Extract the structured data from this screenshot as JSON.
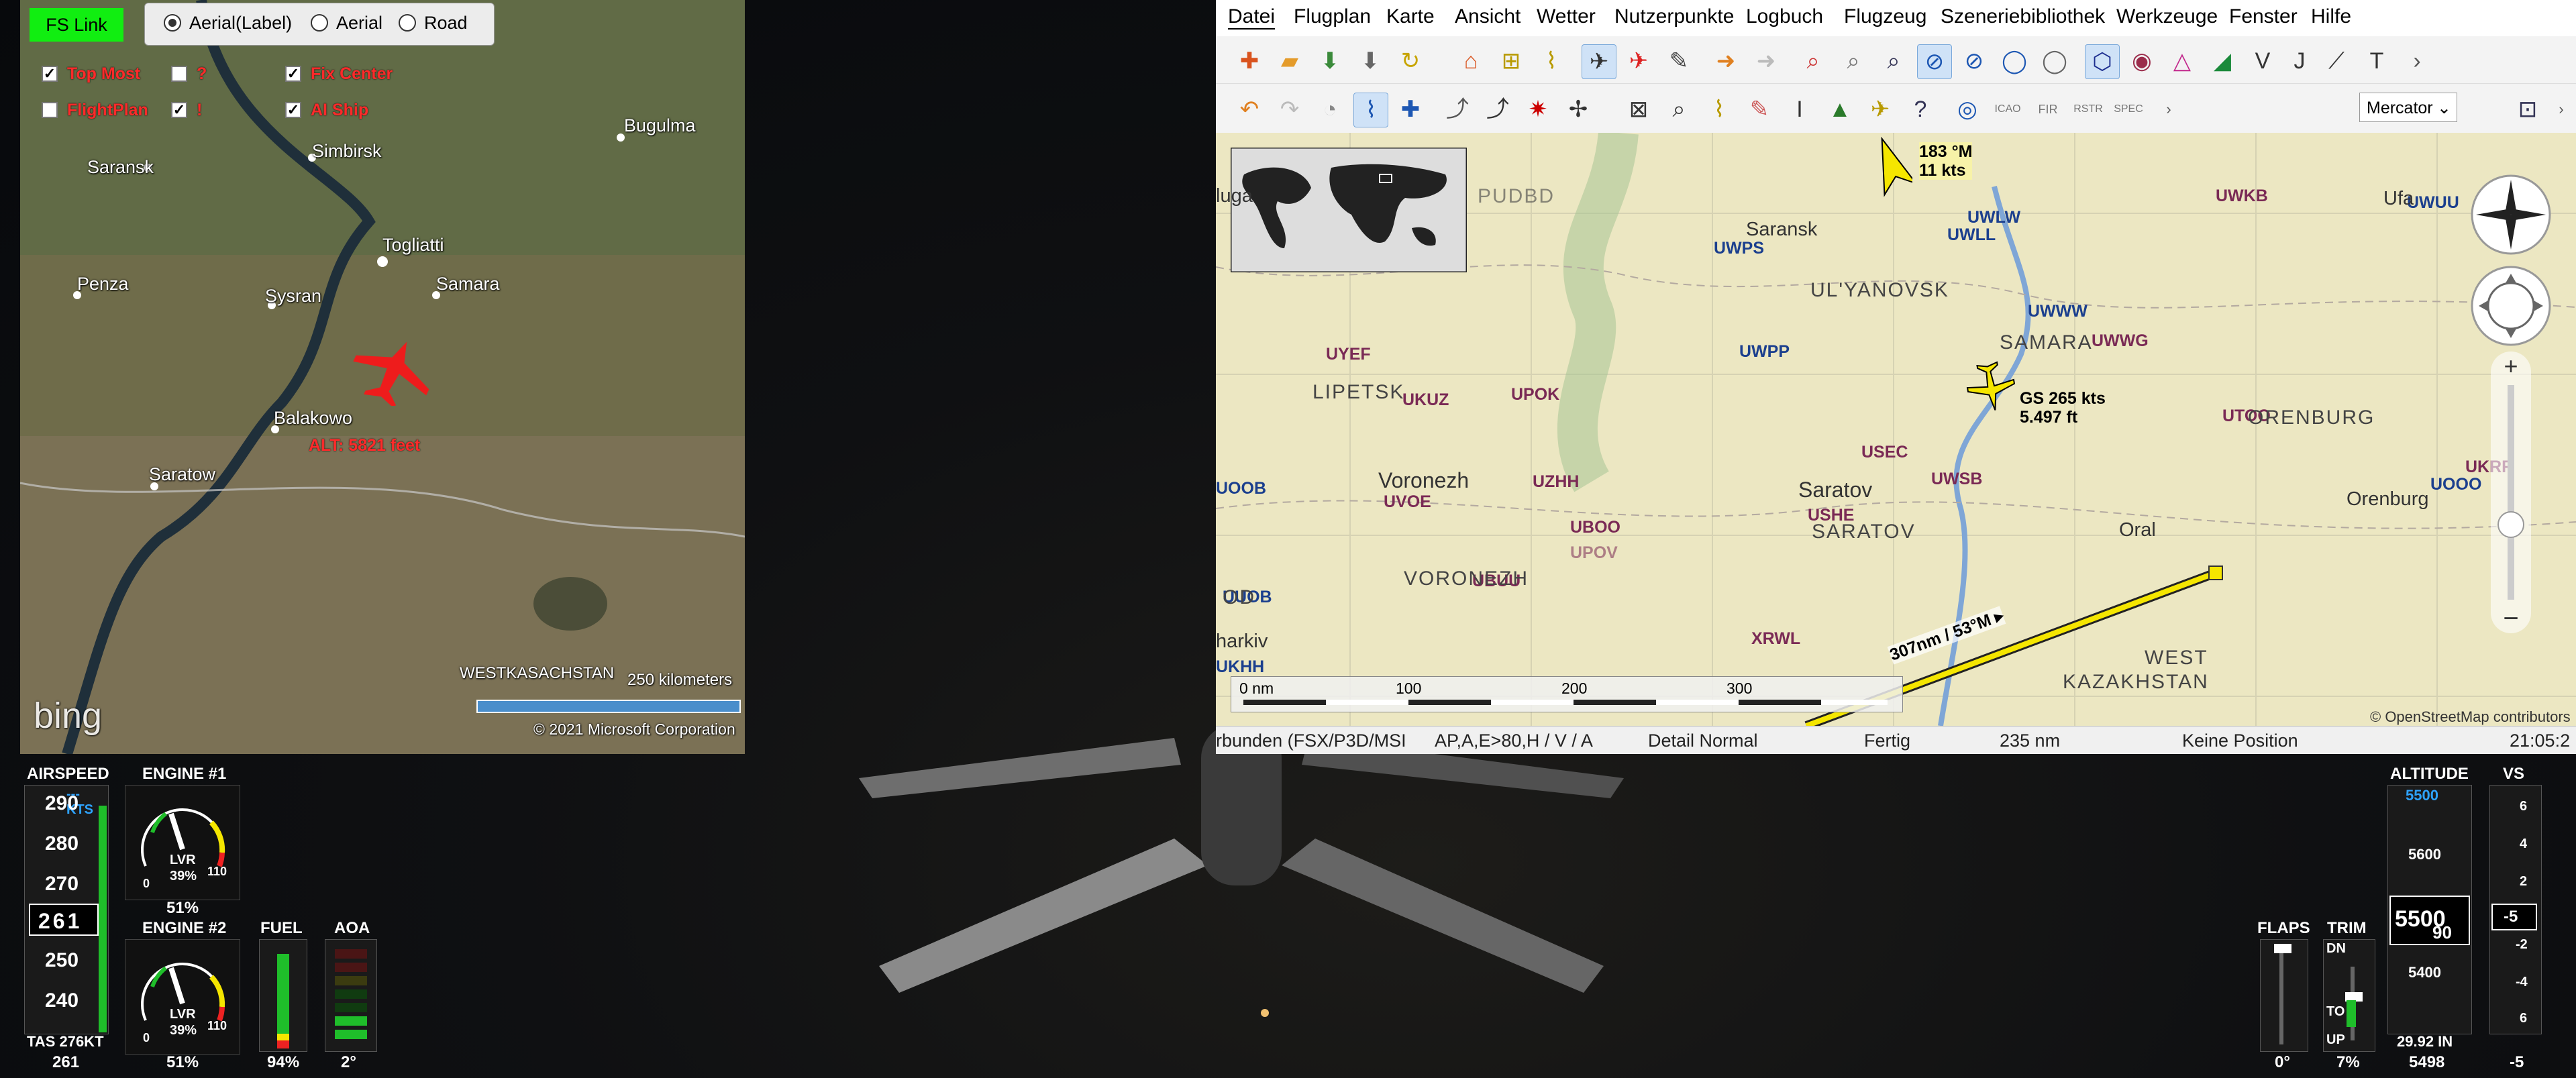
{
  "bing": {
    "fslink_label": "FS Link",
    "modes": [
      "Aerial(Label)",
      "Aerial",
      "Road"
    ],
    "checkboxes": [
      {
        "label": "Top Most",
        "checked": true
      },
      {
        "label": "?",
        "checked": false
      },
      {
        "label": "Fix Center",
        "checked": true
      },
      {
        "label": "FlightPlan",
        "checked": false
      },
      {
        "label": "!",
        "checked": true
      },
      {
        "label": "AI Ship",
        "checked": true
      }
    ],
    "places": [
      "Saransk",
      "Simbirsk",
      "Bugulma",
      "Togliatti",
      "Samara",
      "Penza",
      "Sysran",
      "Balakowo",
      "Saratow",
      "WESTKASACHSTAN"
    ],
    "altitude_text": "ALT: 5821 feet",
    "scale_text": "250 kilometers",
    "logo": "bing",
    "copyright": "© 2021 Microsoft Corporation"
  },
  "lnm": {
    "menu": [
      "Datei",
      "Flugplan",
      "Karte",
      "Ansicht",
      "Wetter",
      "Nutzerpunkte",
      "Logbuch",
      "Flugzeug",
      "Szeneriebibliothek",
      "Werkzeuge",
      "Fenster",
      "Hilfe"
    ],
    "projection": "Mercator",
    "wind_label": {
      "line1": "183 °M",
      "line2": "11 kts"
    },
    "aircraft_label": {
      "line1": "GS 265 kts",
      "line2": "5.497 ft"
    },
    "route_label": "307nm / 53°M ▸",
    "airports_blue": [
      "UWPS",
      "UWLW",
      "UWLL",
      "UWUU",
      "UWWW",
      "UWWG",
      "UWPP",
      "UOOB",
      "UUOB",
      "UKHH",
      "UOOO"
    ],
    "airports_purple": [
      "UWKB",
      "UYEF",
      "UKUZ",
      "UPOK",
      "USEC",
      "UWSB",
      "UTOO",
      "UKRR",
      "UZHH",
      "UVOE",
      "UBOO",
      "UPOV",
      "USHE",
      "UBUU",
      "XRWL"
    ],
    "cities": [
      "Saransk",
      "Saratov",
      "Voronezh",
      "Orenburg",
      "Oral",
      "Ufa",
      "LIPETSK",
      "SAMARA",
      "UL'YANOVSK",
      "ORENBURG"
    ],
    "regions": [
      "SARATOV",
      "VORONEZH",
      "WEST",
      "KAZAKHSTAN",
      "OD",
      "harkiv",
      "luga",
      "PUDBD"
    ],
    "scale": [
      "0 nm",
      "100",
      "200",
      "300"
    ],
    "attribution": "© OpenStreetMap contributors",
    "status": [
      "rbunden (FSX/P3D/MSI",
      "AP,A,E>80,H / V / A",
      "Detail Normal",
      "Fertig",
      "235 nm",
      "Keine Position",
      "21:05:2"
    ]
  },
  "instruments": {
    "airspeed": {
      "title": "AIRSPEED",
      "unit": "--- KTS",
      "ticks": [
        "290",
        "280",
        "270",
        "250",
        "240"
      ],
      "current": "261",
      "tas_label": "TAS 276KT",
      "bottom": "261"
    },
    "engine1": {
      "title": "ENGINE #1",
      "lvr": "LVR",
      "percent_in": "39%",
      "min": "0",
      "max": "110",
      "bottom": "51%"
    },
    "engine2": {
      "title": "ENGINE #2",
      "lvr": "LVR",
      "percent_in": "39%",
      "min": "0",
      "max": "110",
      "bottom": "51%"
    },
    "fuel": {
      "title": "FUEL",
      "bottom": "94%",
      "level": 0.94
    },
    "aoa": {
      "title": "AOA",
      "bottom": "2°"
    },
    "flaps": {
      "title": "FLAPS",
      "bottom": "0°"
    },
    "trim": {
      "title": "TRIM",
      "dn": "DN",
      "to": "TO",
      "up": "UP",
      "bottom": "7%"
    },
    "altitude": {
      "title": "ALTITUDE",
      "selected": "5500",
      "ticks": [
        "5600",
        "5400"
      ],
      "current_big": "5500",
      "current_small": "90",
      "baro": "29.92 IN",
      "bottom": "5498"
    },
    "vs": {
      "title": "VS",
      "ticks": [
        "6",
        "4",
        "2",
        "-2",
        "-4",
        "6"
      ],
      "current": "-5",
      "bottom": "-5"
    }
  },
  "colors": {
    "fslink": "#11ee11",
    "bing_red": "#ff2a2a",
    "route": "#f5e600",
    "apt_blue": "#1b3f8e",
    "apt_purple": "#7a2a55"
  }
}
